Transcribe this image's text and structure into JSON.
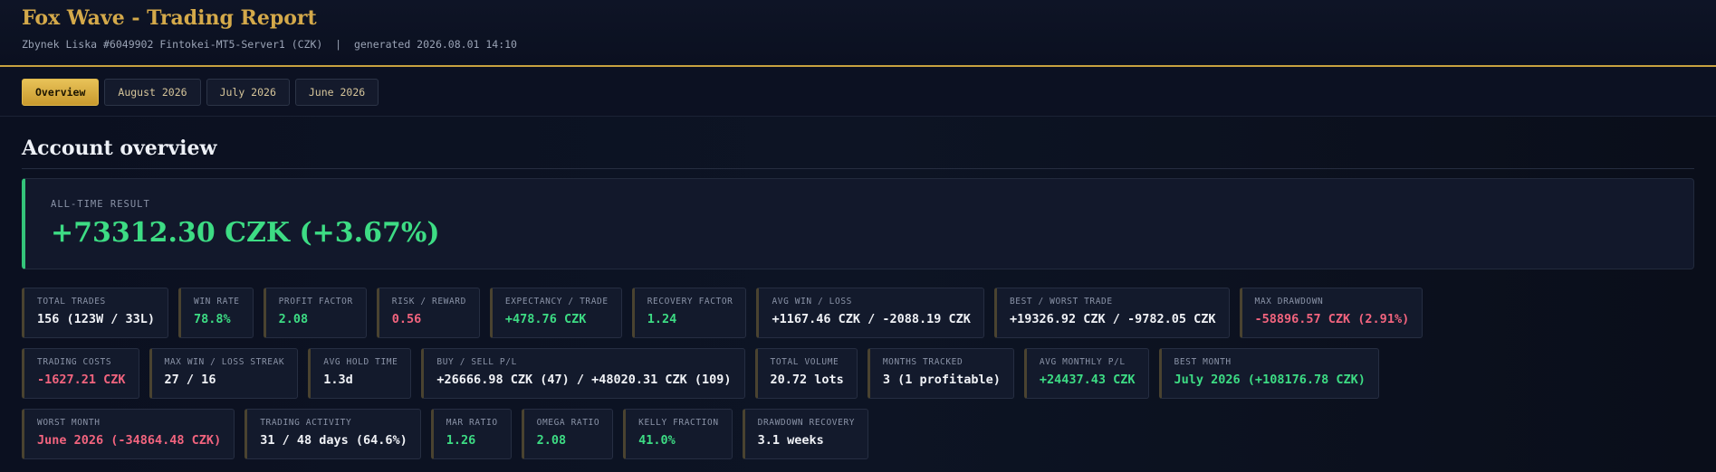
{
  "header": {
    "title": "Fox Wave - Trading Report",
    "subtitle": "Zbynek Liska #6049902 Fintokei-MT5-Server1 (CZK)  |  generated 2026.08.01 14:10"
  },
  "tabs": [
    "Overview",
    "August 2026",
    "July 2026",
    "June 2026"
  ],
  "section_title": "Account overview",
  "hero": {
    "label": "ALL-TIME RESULT",
    "value": "+73312.30 CZK (+3.67%)"
  },
  "row1": [
    {
      "label": "TOTAL TRADES",
      "value": "156 (123W / 33L)",
      "tone": "neutral"
    },
    {
      "label": "WIN RATE",
      "value": "78.8%",
      "tone": "pos"
    },
    {
      "label": "PROFIT FACTOR",
      "value": "2.08",
      "tone": "pos"
    },
    {
      "label": "RISK / REWARD",
      "value": "0.56",
      "tone": "neg"
    },
    {
      "label": "EXPECTANCY / TRADE",
      "value": "+478.76 CZK",
      "tone": "pos"
    },
    {
      "label": "RECOVERY FACTOR",
      "value": "1.24",
      "tone": "pos"
    },
    {
      "label": "AVG WIN / LOSS",
      "value": "+1167.46 CZK / -2088.19 CZK",
      "tone": "neutral"
    },
    {
      "label": "BEST / WORST TRADE",
      "value": "+19326.92 CZK / -9782.05 CZK",
      "tone": "neutral"
    },
    {
      "label": "MAX DRAWDOWN",
      "value": "-58896.57 CZK (2.91%)",
      "tone": "neg"
    }
  ],
  "row2": [
    {
      "label": "TRADING COSTS",
      "value": "-1627.21 CZK",
      "tone": "neg"
    },
    {
      "label": "MAX WIN / LOSS STREAK",
      "value": "27 / 16",
      "tone": "neutral"
    },
    {
      "label": "AVG HOLD TIME",
      "value": "1.3d",
      "tone": "neutral"
    },
    {
      "label": "BUY / SELL P/L",
      "value": "+26666.98 CZK (47) / +48020.31 CZK (109)",
      "tone": "neutral"
    },
    {
      "label": "TOTAL VOLUME",
      "value": "20.72 lots",
      "tone": "neutral"
    },
    {
      "label": "MONTHS TRACKED",
      "value": "3 (1 profitable)",
      "tone": "neutral"
    },
    {
      "label": "AVG MONTHLY P/L",
      "value": "+24437.43 CZK",
      "tone": "pos"
    },
    {
      "label": "BEST MONTH",
      "value": "July 2026 (+108176.78 CZK)",
      "tone": "pos"
    }
  ],
  "row3": [
    {
      "label": "WORST MONTH",
      "value": "June 2026 (-34864.48 CZK)",
      "tone": "neg"
    },
    {
      "label": "TRADING ACTIVITY",
      "value": "31 / 48 days (64.6%)",
      "tone": "neutral"
    },
    {
      "label": "MAR RATIO",
      "value": "1.26",
      "tone": "pos"
    },
    {
      "label": "OMEGA RATIO",
      "value": "2.08",
      "tone": "pos"
    },
    {
      "label": "KELLY FRACTION",
      "value": "41.0%",
      "tone": "pos"
    },
    {
      "label": "DRAWDOWN RECOVERY",
      "value": "3.1 weeks",
      "tone": "neutral"
    }
  ],
  "colors": {
    "accent": "#d4a94a",
    "positive": "#3ddc84",
    "negative": "#f2647e",
    "background": "#0a0e1a"
  }
}
